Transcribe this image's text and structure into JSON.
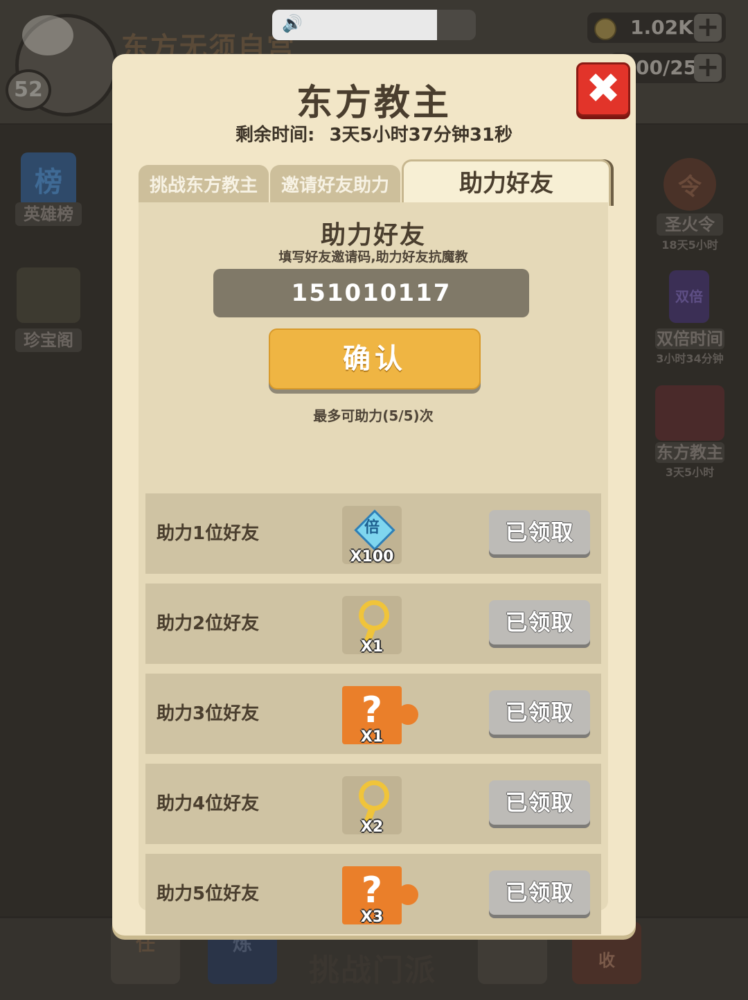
{
  "background": {
    "player_name": "东方无须自宫",
    "level": "52",
    "resources": [
      {
        "value": "1.02K"
      },
      {
        "value": "00/25"
      }
    ],
    "left_side": [
      {
        "icon_text": "榜",
        "label": "英雄榜"
      },
      {
        "label": "珍宝阁"
      }
    ],
    "right_side": [
      {
        "icon_text": "令",
        "label": "圣火令",
        "sub": "18天5小时"
      },
      {
        "icon_text": "双倍",
        "label": "双倍时间",
        "sub": "3小时34分钟"
      },
      {
        "label": "东方教主",
        "sub": "3天5小时"
      }
    ],
    "bottom_main_button": "挑战门派",
    "bottom_icon_texts": [
      "任",
      "炼",
      "收"
    ]
  },
  "modal": {
    "title": "东方教主",
    "timer_label": "剩余时间:",
    "timer_value": "3天5小时37分钟31秒",
    "tabs": [
      {
        "label": "挑战东方教主",
        "active": false
      },
      {
        "label": "邀请好友助力",
        "active": false
      },
      {
        "label": "助力好友",
        "active": true
      }
    ],
    "section_title": "助力好友",
    "section_subtitle": "填写好友邀请码,助力好友抗魔教",
    "invite_code": "151010117",
    "confirm_label": "确认",
    "limit_text": "最多可助力(5/5)次",
    "rows": [
      {
        "label": "助力1位好友",
        "reward_icon": "double-gem-icon",
        "reward_char": "倍",
        "reward_qty": "X100",
        "button": "已领取"
      },
      {
        "label": "助力2位好友",
        "reward_icon": "gold-key-icon",
        "reward_qty": "X1",
        "button": "已领取"
      },
      {
        "label": "助力3位好友",
        "reward_icon": "mystery-puzzle-icon",
        "reward_char": "?",
        "reward_qty": "X1",
        "button": "已领取"
      },
      {
        "label": "助力4位好友",
        "reward_icon": "gold-key-icon",
        "reward_qty": "X2",
        "button": "已领取"
      },
      {
        "label": "助力5位好友",
        "reward_icon": "mystery-puzzle-icon",
        "reward_char": "?",
        "reward_qty": "X3",
        "button": "已领取"
      }
    ]
  },
  "colors": {
    "modal_bg": "#f2e6c7",
    "panel_bg": "#e5d9b8",
    "confirm_orange": "#efb543",
    "close_red": "#e2342a",
    "claimed_gray": "#bdbbb7"
  }
}
